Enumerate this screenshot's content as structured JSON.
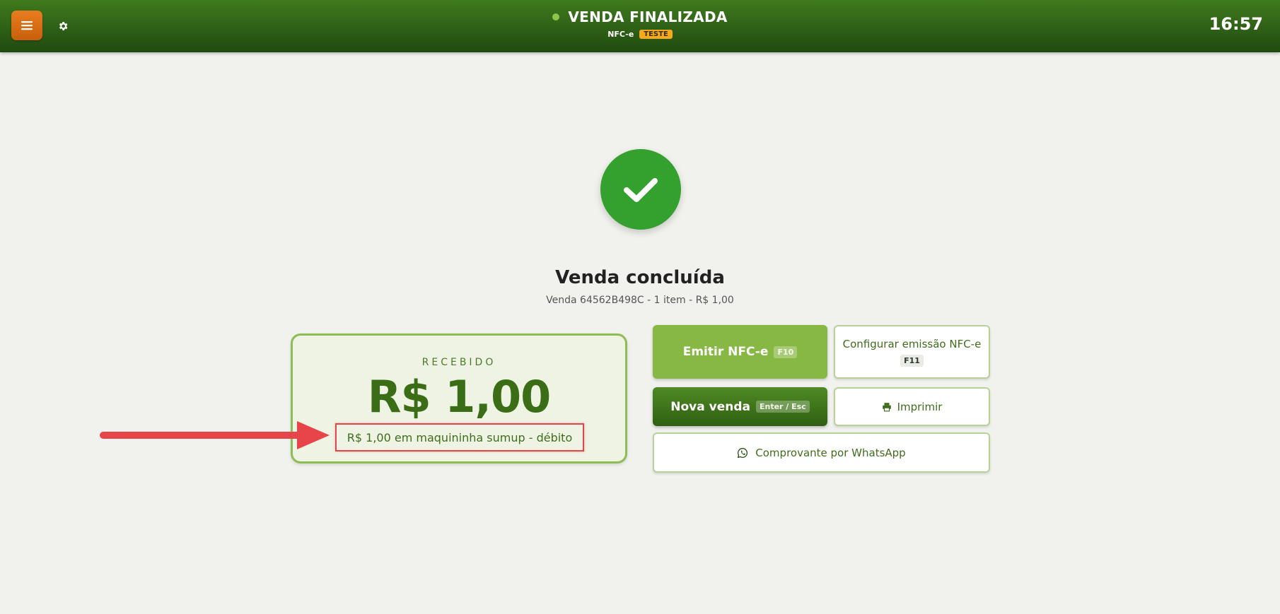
{
  "header": {
    "title": "VENDA FINALIZADA",
    "doc_type": "NFC-e",
    "env_badge": "TESTE",
    "clock": "16:57",
    "menu_icon": "hamburger-icon",
    "settings_icon": "gear-icon"
  },
  "main": {
    "status_icon": "check-icon",
    "title": "Venda concluída",
    "subtitle": "Venda 64562B498C - 1 item - R$ 1,00"
  },
  "received": {
    "label": "RECEBIDO",
    "amount": "R$ 1,00",
    "detail": "R$ 1,00 em maquininha sumup - débito"
  },
  "actions": {
    "emitir": {
      "label": "Emitir NFC-e",
      "shortcut": "F10"
    },
    "configurar": {
      "label": "Configurar emissão NFC-e",
      "shortcut": "F11"
    },
    "nova_venda": {
      "label": "Nova venda",
      "shortcut": "Enter / Esc"
    },
    "imprimir": {
      "label": "Imprimir",
      "icon": "printer-icon"
    },
    "whatsapp": {
      "label": "Comprovante por WhatsApp",
      "icon": "whatsapp-icon"
    }
  },
  "colors": {
    "header": "#2e6016",
    "menu_button": "#e97d1f",
    "success": "#34a02e",
    "accent": "#86b843",
    "annotation": "#e0474c"
  }
}
